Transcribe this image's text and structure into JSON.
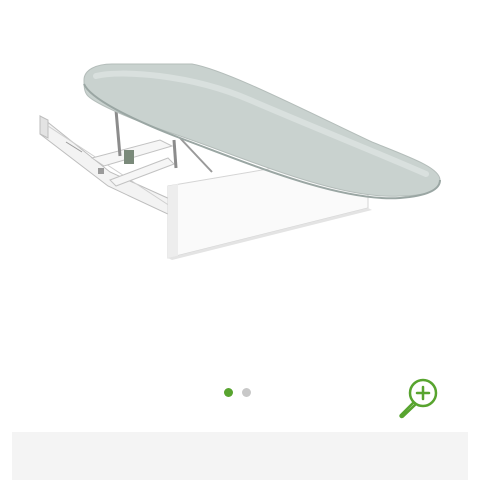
{
  "product": {
    "image_alt_icon": "ironing-board-image",
    "board_cover_color": "#c9d2cf",
    "frame_color": "#f6f6f6"
  },
  "carousel": {
    "total_slides": 2,
    "active_index": 0,
    "active_color": "#58a42f",
    "inactive_color": "#c8c8c8"
  },
  "zoom": {
    "icon": "zoom-in-icon",
    "color": "#58a42f"
  },
  "bottom_bar": {
    "color": "#f4f4f4"
  }
}
